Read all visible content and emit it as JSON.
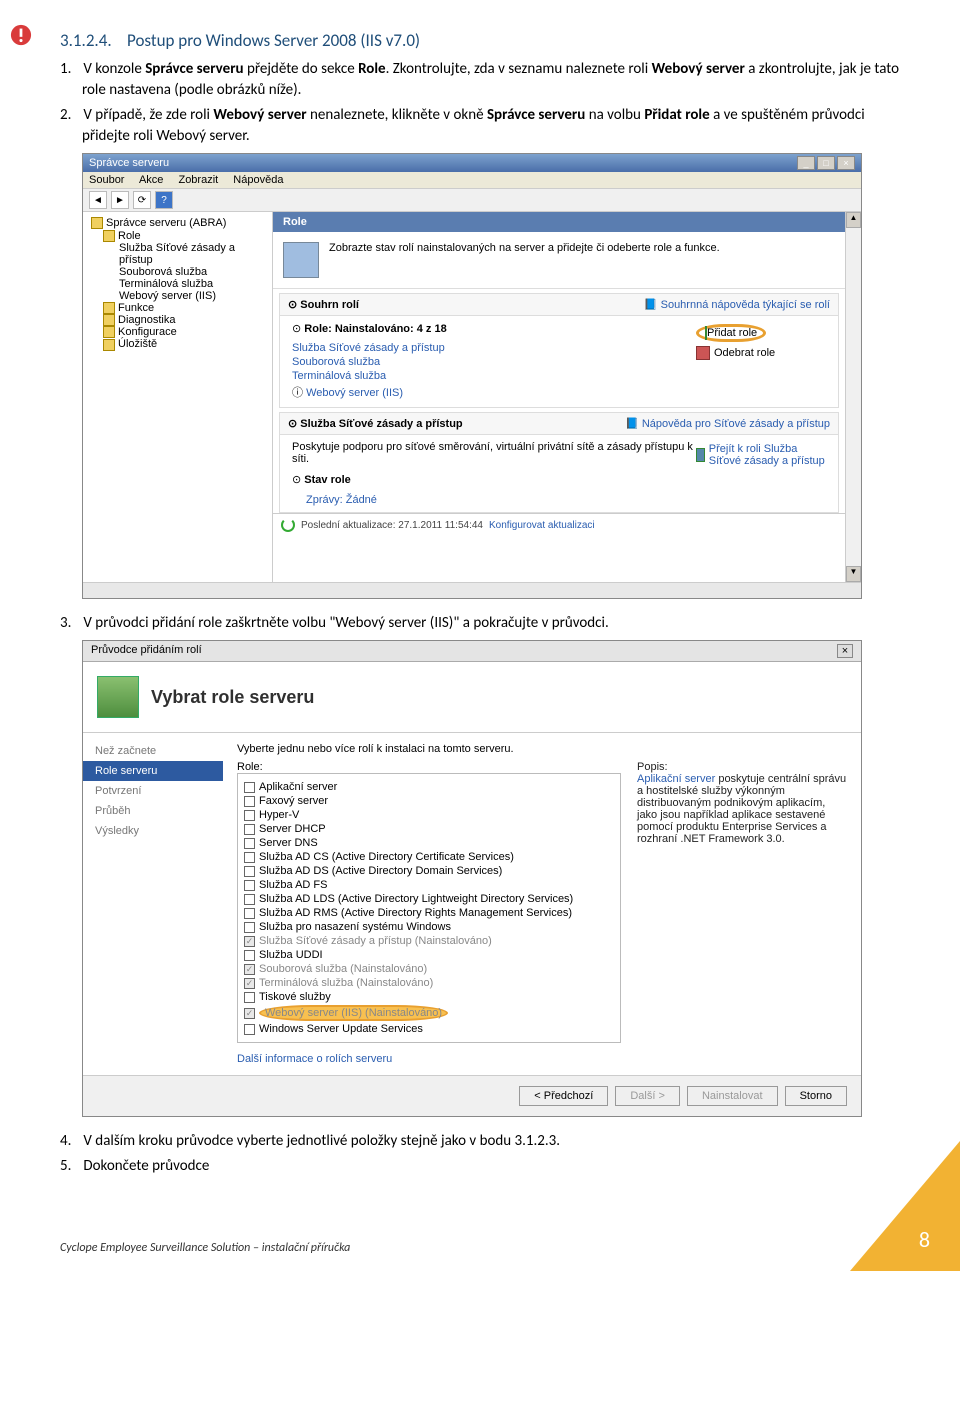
{
  "heading": {
    "num": "3.1.2.4.",
    "title": "Postup pro Windows Server 2008 (IIS v7.0)"
  },
  "items": {
    "1": {
      "n": "1.",
      "text_a": "V konzole ",
      "b1": "Správce serveru",
      "text_b": " přejděte do sekce ",
      "b2": "Role",
      "text_c": ". Zkontrolujte, zda v seznamu naleznete roli ",
      "b3": "Webový server",
      "text_d": " a zkontrolujte, jak je tato role nastavena (podle obrázků níže)."
    },
    "2": {
      "n": "2.",
      "text_a": "V případě, že zde roli ",
      "b1": "Webový server",
      "text_b": " nenaleznete, klikněte v okně ",
      "b2": "Správce serveru",
      "text_c": " na volbu ",
      "b3": "Přidat role",
      "text_d": " a ve spuštěném průvodci přidejte roli Webový server."
    },
    "3": {
      "n": "3.",
      "text": "V průvodci přidání role zaškrtněte volbu \"Webový server (IIS)\" a pokračujte v průvodci."
    },
    "4": {
      "n": "4.",
      "text": "V dalším kroku průvodce vyberte jednotlivé položky stejně jako v bodu 3.1.2.3."
    },
    "5": {
      "n": "5.",
      "text": "Dokončete průvodce"
    }
  },
  "sm": {
    "title": "Správce serveru",
    "menu": {
      "soubor": "Soubor",
      "akce": "Akce",
      "zobrazit": "Zobrazit",
      "napoveda": "Nápověda"
    },
    "tree": {
      "root": "Správce serveru (ABRA)",
      "role": "Role",
      "role_children": [
        "Služba Síťové zásady a přístup",
        "Souborová služba",
        "Terminálová služba",
        "Webový server (IIS)"
      ],
      "funkce": "Funkce",
      "diagnostika": "Diagnostika",
      "konfigurace": "Konfigurace",
      "uloziste": "Úložiště"
    },
    "rolehdr": "Role",
    "desc": "Zobrazte stav rolí nainstalovaných na server a přidejte či odeberte role a funkce.",
    "panels": {
      "souhrn": {
        "title": "Souhrn rolí",
        "help": "Souhrnná nápověda týkající se rolí"
      },
      "roleinfo": {
        "label": "Role: Nainstalováno: 4 z 18",
        "add": "Přidat role",
        "remove": "Odebrat role"
      },
      "rolelist": [
        "Služba Síťové zásady a přístup",
        "Souborová služba",
        "Terminálová služba",
        "Webový server (IIS)"
      ],
      "sluzba": {
        "title": "Služba Síťové zásady a přístup",
        "help": "Nápověda pro Síťové zásady a přístup",
        "desc": "Poskytuje podporu pro síťové směrování, virtuální privátní sítě a zásady přístupu k síti.",
        "goto": "Přejít k roli Služba Síťové zásady a přístup"
      },
      "stav": {
        "title": "Stav role",
        "msg": "Zprávy: Žádné"
      }
    },
    "status": {
      "text": "Poslední aktualizace: 27.1.2011 11:54:44",
      "link": "Konfigurovat aktualizaci"
    }
  },
  "arw": {
    "title": "Průvodce přidáním rolí",
    "hdr": "Vybrat role serveru",
    "steps": [
      "Než začnete",
      "Role serveru",
      "Potvrzení",
      "Průběh",
      "Výsledky"
    ],
    "lead": "Vyberte jednu nebo více rolí k instalaci na tomto serveru.",
    "role_label": "Role:",
    "popis_label": "Popis:",
    "roles": [
      {
        "label": "Aplikační server",
        "checked": false,
        "disabled": false
      },
      {
        "label": "Faxový server",
        "checked": false,
        "disabled": false
      },
      {
        "label": "Hyper-V",
        "checked": false,
        "disabled": false
      },
      {
        "label": "Server DHCP",
        "checked": false,
        "disabled": false
      },
      {
        "label": "Server DNS",
        "checked": false,
        "disabled": false
      },
      {
        "label": "Služba AD CS (Active Directory Certificate Services)",
        "checked": false,
        "disabled": false
      },
      {
        "label": "Služba AD DS (Active Directory Domain Services)",
        "checked": false,
        "disabled": false
      },
      {
        "label": "Služba AD FS",
        "checked": false,
        "disabled": false
      },
      {
        "label": "Služba AD LDS (Active Directory Lightweight Directory Services)",
        "checked": false,
        "disabled": false
      },
      {
        "label": "Služba AD RMS (Active Directory Rights Management Services)",
        "checked": false,
        "disabled": false
      },
      {
        "label": "Služba pro nasazení systému Windows",
        "checked": false,
        "disabled": false
      },
      {
        "label": "Služba Síťové zásady a přístup (Nainstalováno)",
        "checked": true,
        "disabled": true
      },
      {
        "label": "Služba UDDI",
        "checked": false,
        "disabled": false
      },
      {
        "label": "Souborová služba (Nainstalováno)",
        "checked": true,
        "disabled": true
      },
      {
        "label": "Terminálová služba (Nainstalováno)",
        "checked": true,
        "disabled": true
      },
      {
        "label": "Tiskové služby",
        "checked": false,
        "disabled": false
      },
      {
        "label": "Webový server (IIS) (Nainstalováno)",
        "checked": true,
        "disabled": true,
        "highlight": true
      },
      {
        "label": "Windows Server Update Services",
        "checked": false,
        "disabled": false
      }
    ],
    "popis_link": "Aplikační server",
    "popis": " poskytuje centrální správu a hostitelské služby výkonným distribuovaným podnikovým aplikacím, jako jsou například aplikace sestavené pomocí produktu Enterprise Services a rozhraní .NET Framework 3.0.",
    "more": "Další informace o rolích serveru",
    "btns": {
      "prev": "< Předchozí",
      "next": "Další >",
      "install": "Nainstalovat",
      "cancel": "Storno"
    }
  },
  "footer": "Cyclope Employee Surveillance Solution – instalační příručka",
  "pagenum": "8"
}
